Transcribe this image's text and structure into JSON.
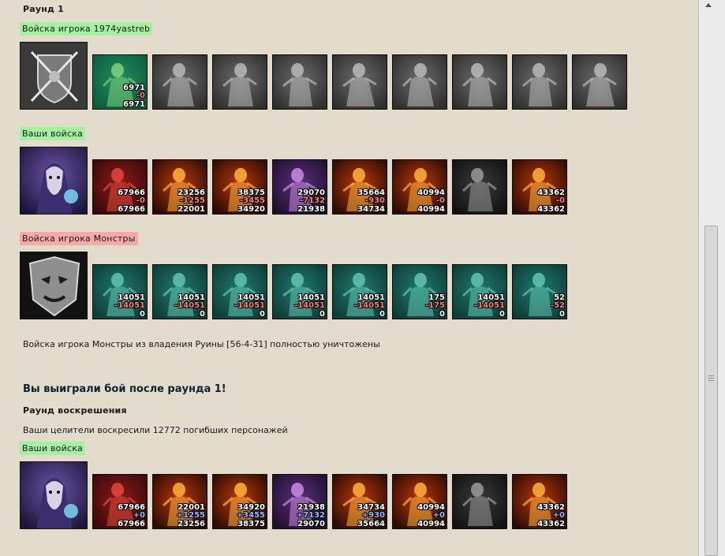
{
  "round_title": "Раунд 1",
  "sections": [
    {
      "label": "Войска игрока 1974yastreb",
      "label_color": "green",
      "leader": "crossed-arrows-crest",
      "units": [
        {
          "icon": "gnome-archer-portrait",
          "theme": "green",
          "n1": "6971",
          "n2": "-0",
          "n3": "6971"
        },
        {
          "icon": "locked-swordsman-portrait",
          "theme": "gray"
        },
        {
          "icon": "locked-warrior-portrait",
          "theme": "gray"
        },
        {
          "icon": "locked-knight-portrait",
          "theme": "gray"
        },
        {
          "icon": "locked-griffin-portrait",
          "theme": "gray"
        },
        {
          "icon": "locked-archer-portrait",
          "theme": "gray"
        },
        {
          "icon": "locked-mage-portrait",
          "theme": "gray"
        },
        {
          "icon": "locked-monk-portrait",
          "theme": "gray"
        },
        {
          "icon": "locked-angel-portrait",
          "theme": "gray"
        }
      ]
    },
    {
      "label": "Ваши войска",
      "label_color": "green",
      "leader": "undead-wizard-portrait",
      "units": [
        {
          "icon": "bone-dragon-portrait",
          "theme": "red",
          "n1": "67966",
          "n2": "-0",
          "n3": "67966"
        },
        {
          "icon": "skeleton-archer-portrait",
          "theme": "fire",
          "n1": "23256",
          "n2": "-1255",
          "n3": "22001"
        },
        {
          "icon": "hell-hound-portrait",
          "theme": "fire",
          "n1": "38375",
          "n2": "-3455",
          "n3": "34920"
        },
        {
          "icon": "shadow-dragon-portrait",
          "theme": "purple",
          "n1": "29070",
          "n2": "-7132",
          "n3": "21938"
        },
        {
          "icon": "fire-beast-portrait",
          "theme": "fire",
          "n1": "35664",
          "n2": "-930",
          "n3": "34734"
        },
        {
          "icon": "demon-warrior-portrait",
          "theme": "fire",
          "n1": "40994",
          "n2": "-0",
          "n3": "40994"
        },
        {
          "icon": "horned-demon-portrait",
          "theme": "dark"
        },
        {
          "icon": "pit-lord-portrait",
          "theme": "fire",
          "n1": "43362",
          "n2": "-0",
          "n3": "43362"
        }
      ]
    },
    {
      "label": "Войска игрока Монстры",
      "label_color": "red",
      "leader": "stone-face-crest",
      "units": [
        {
          "icon": "lizard-monster-portrait",
          "theme": "teal",
          "n1": "14051",
          "n2": "-14051",
          "n3": "0"
        },
        {
          "icon": "skull-golem-portrait",
          "theme": "teal",
          "n1": "14051",
          "n2": "-14051",
          "n3": "0"
        },
        {
          "icon": "orc-shaman-portrait",
          "theme": "teal",
          "n1": "14051",
          "n2": "-14051",
          "n3": "0"
        },
        {
          "icon": "red-gargoyle-portrait",
          "theme": "teal",
          "n1": "14051",
          "n2": "-14051",
          "n3": "0"
        },
        {
          "icon": "spiked-beast-portrait",
          "theme": "teal",
          "n1": "14051",
          "n2": "-14051",
          "n3": "0"
        },
        {
          "icon": "crimson-demon-portrait",
          "theme": "teal",
          "n1": "175",
          "n2": "-175",
          "n3": "0"
        },
        {
          "icon": "red-crystal-portrait",
          "theme": "teal",
          "n1": "14051",
          "n2": "-14051",
          "n3": "0"
        },
        {
          "icon": "tentacle-demon-portrait",
          "theme": "teal",
          "n1": "52",
          "n2": "-52",
          "n3": "0"
        }
      ]
    }
  ],
  "destroyed_message": "Войска игрока Монстры из владения Руины [56-4-31] полностью уничтожены",
  "victory_message": "Вы выиграли бой после раунда 1!",
  "resurrection_title": "Раунд воскрешения",
  "resurrection_message": "Ваши целители воскресили 12772 погибших персонажей",
  "final_section": {
    "label": "Ваши войска",
    "label_color": "green",
    "leader": "undead-wizard-portrait",
    "units": [
      {
        "icon": "bone-dragon-portrait",
        "theme": "red",
        "n1": "67966",
        "n2": "+0",
        "n3": "67966"
      },
      {
        "icon": "skeleton-archer-portrait",
        "theme": "fire",
        "n1": "22001",
        "n2": "+1255",
        "n3": "23256"
      },
      {
        "icon": "hell-hound-portrait",
        "theme": "fire",
        "n1": "34920",
        "n2": "+3455",
        "n3": "38375"
      },
      {
        "icon": "shadow-dragon-portrait",
        "theme": "purple",
        "n1": "21938",
        "n2": "+7132",
        "n3": "29070"
      },
      {
        "icon": "fire-beast-portrait",
        "theme": "fire",
        "n1": "34734",
        "n2": "+930",
        "n3": "35664"
      },
      {
        "icon": "demon-warrior-portrait",
        "theme": "fire",
        "n1": "40994",
        "n2": "+0",
        "n3": "40994"
      },
      {
        "icon": "horned-demon-portrait",
        "theme": "dark"
      },
      {
        "icon": "pit-lord-portrait",
        "theme": "fire",
        "n1": "43362",
        "n2": "+0",
        "n3": "43362"
      }
    ]
  },
  "colors": {
    "background": "#e3dbcb",
    "friendly_tag": "#a4f0a0",
    "enemy_tag": "#f5a9a9",
    "loss_number": "#ff7e7e",
    "gain_number": "#9fb6ff"
  }
}
